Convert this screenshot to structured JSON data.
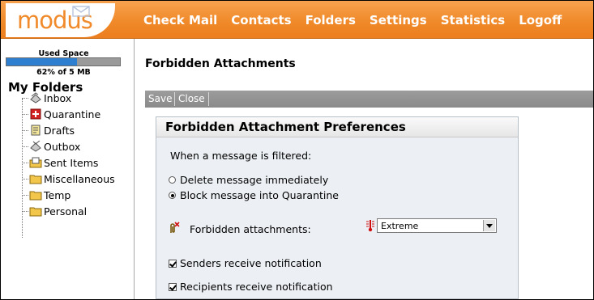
{
  "app": {
    "logo": "modus"
  },
  "nav": {
    "items": [
      "Check Mail",
      "Contacts",
      "Folders",
      "Settings",
      "Statistics",
      "Logoff"
    ]
  },
  "sidebar": {
    "used_space_label": "Used Space",
    "used_space_text": "62% of 5 MB",
    "used_space_fraction": 0.62,
    "folders_title": "My Folders",
    "folders": [
      {
        "label": "Inbox",
        "icon": "inbox-icon"
      },
      {
        "label": "Quarantine",
        "icon": "quarantine-icon"
      },
      {
        "label": "Drafts",
        "icon": "drafts-icon"
      },
      {
        "label": "Outbox",
        "icon": "outbox-icon"
      },
      {
        "label": "Sent Items",
        "icon": "sent-items-icon"
      },
      {
        "label": "Miscellaneous",
        "icon": "folder-icon"
      },
      {
        "label": "Temp",
        "icon": "folder-icon"
      },
      {
        "label": "Personal",
        "icon": "folder-icon"
      }
    ]
  },
  "main": {
    "page_title": "Forbidden Attachments",
    "toolbar": {
      "save_label": "Save",
      "close_label": "Close"
    },
    "panel": {
      "title": "Forbidden Attachment Preferences",
      "filtered_label": "When a message is filtered:",
      "options": [
        {
          "label": "Delete message immediately",
          "selected": false
        },
        {
          "label": "Block message into Quarantine",
          "selected": true
        }
      ],
      "forbidden_label": "Forbidden attachments:",
      "forbidden_value": "Extreme",
      "checks": [
        {
          "label": "Senders receive notification",
          "checked": true
        },
        {
          "label": "Recipients receive notification",
          "checked": true
        }
      ]
    }
  },
  "colors": {
    "accent": "#f08a2a",
    "usage_fill": "#2f7fd0",
    "folder_yellow": "#f2c64a"
  }
}
